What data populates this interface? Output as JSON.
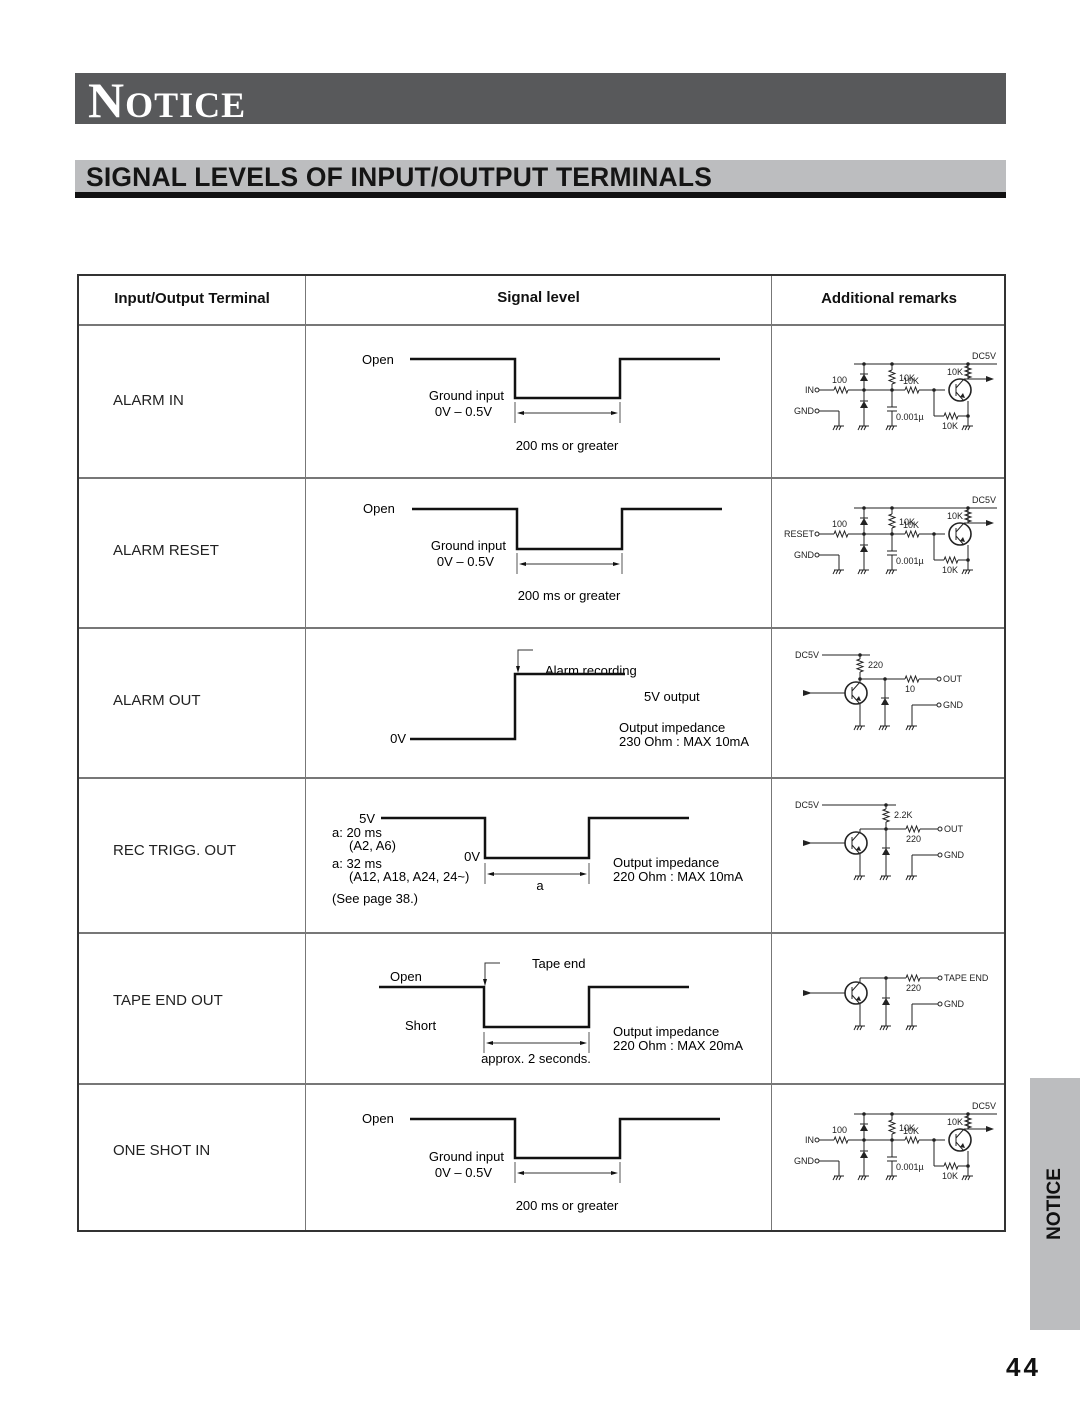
{
  "header": {
    "banner_title_initial": "N",
    "banner_title_rest": "OTICE",
    "section_title": "SIGNAL LEVELS OF INPUT/OUTPUT TERMINALS"
  },
  "table": {
    "columns": [
      "Input/Output Terminal",
      "Signal level",
      "Additional remarks"
    ],
    "rows": [
      {
        "terminal": "ALARM IN",
        "signal": {
          "high_label": "Open",
          "low_label": "Ground input",
          "low_range": "0V – 0.5V",
          "duration": "200 ms or greater"
        },
        "circuit": {
          "input": "IN",
          "gnd": "GND",
          "supply": "DC5V",
          "r_in": "100",
          "r_pull": "10K",
          "r_base": "10K",
          "r_be": "10K",
          "r_col": "10K",
          "cap": "0.001µ"
        }
      },
      {
        "terminal": "ALARM RESET",
        "signal": {
          "high_label": "Open",
          "low_label": "Ground input",
          "low_range": "0V – 0.5V",
          "duration": "200 ms or greater"
        },
        "circuit": {
          "input": "RESET",
          "gnd": "GND",
          "supply": "DC5V",
          "r_in": "100",
          "r_pull": "10K",
          "r_base": "10K",
          "r_be": "10K",
          "r_col": "10K",
          "cap": "0.001µ"
        }
      },
      {
        "terminal": "ALARM OUT",
        "signal": {
          "event": "Alarm recording",
          "high_label": "5V output",
          "low_label": "0V",
          "impedance": "Output impedance",
          "impedance_value": "230 Ohm : MAX 10mA"
        },
        "circuit": {
          "supply": "DC5V",
          "r_pull": "220",
          "r_out": "10",
          "out": "OUT",
          "gnd": "GND"
        }
      },
      {
        "terminal": "REC TRIGG. OUT",
        "signal": {
          "high_label": "5V",
          "low_label": "0V",
          "note1": "a: 20 ms",
          "note1_models": "(A2, A6)",
          "note2": "a: 32 ms",
          "note2_models": "(A12, A18, A24, 24~)",
          "see": "(See page 38.)",
          "width_label": "a",
          "impedance": "Output impedance",
          "impedance_value": "220 Ohm : MAX 10mA"
        },
        "circuit": {
          "supply": "DC5V",
          "r_pull": "2.2K",
          "r_out": "220",
          "out": "OUT",
          "gnd": "GND"
        }
      },
      {
        "terminal": "TAPE END OUT",
        "signal": {
          "event": "Tape end",
          "high_label": "Open",
          "low_label": "Short",
          "duration": "approx. 2 seconds.",
          "impedance": "Output impedance",
          "impedance_value": "220 Ohm : MAX 20mA"
        },
        "circuit": {
          "r_out": "220",
          "out": "TAPE END",
          "gnd": "GND"
        }
      },
      {
        "terminal": "ONE SHOT IN",
        "signal": {
          "high_label": "Open",
          "low_label": "Ground input",
          "low_range": "0V – 0.5V",
          "duration": "200 ms or greater"
        },
        "circuit": {
          "input": "IN",
          "gnd": "GND",
          "supply": "DC5V",
          "r_in": "100",
          "r_pull": "10K",
          "r_base": "10K",
          "r_be": "10K",
          "r_col": "10K",
          "cap": "0.001µ"
        }
      }
    ]
  },
  "side_tab": {
    "label": "NOTICE"
  },
  "footer": {
    "page_number": "44"
  }
}
